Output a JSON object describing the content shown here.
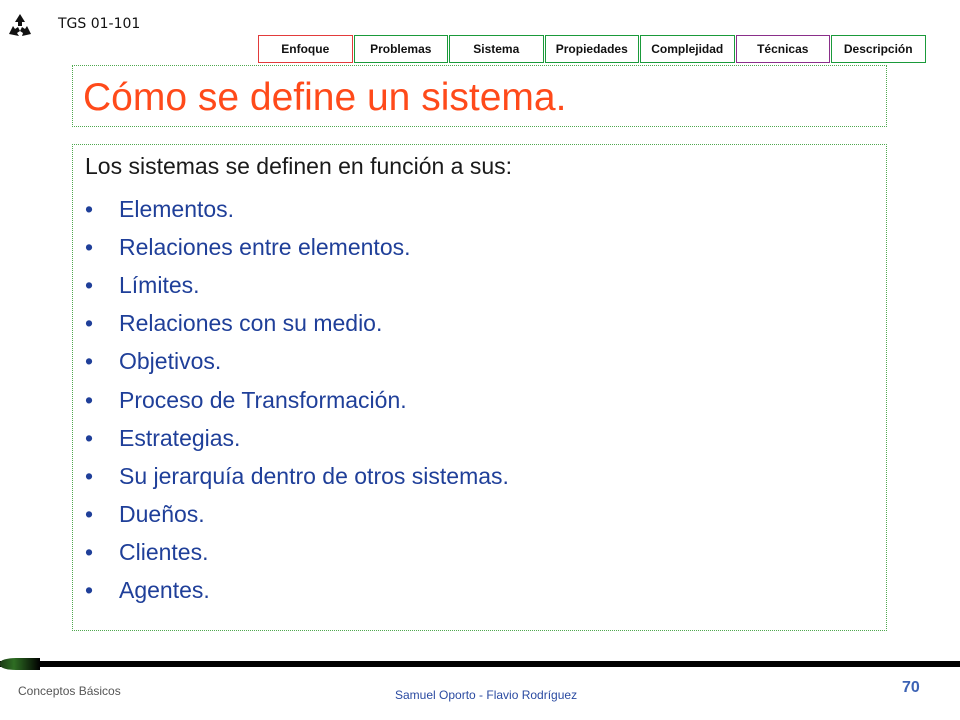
{
  "header": {
    "course_code": "TGS 01-101",
    "logo_icon": "recycle-icon",
    "nav_tabs": [
      {
        "label": "Enfoque",
        "border": "#e23b3b"
      },
      {
        "label": "Problemas",
        "border": "#1a9a3a"
      },
      {
        "label": "Sistema",
        "border": "#1a9a3a"
      },
      {
        "label": "Propiedades",
        "border": "#1a9a3a"
      },
      {
        "label": "Complejidad",
        "border": "#1a9a3a"
      },
      {
        "label": "Técnicas",
        "border": "#8a2f8a"
      },
      {
        "label": "Descripción",
        "border": "#1a9a3a"
      }
    ]
  },
  "slide": {
    "title": "Cómo se define un sistema.",
    "intro": "Los sistemas se definen en función a sus:",
    "bullets": [
      "Elementos.",
      "Relaciones entre elementos.",
      "Límites.",
      "Relaciones con su medio.",
      "Objetivos.",
      "Proceso de Transformación.",
      "Estrategias.",
      "Su jerarquía dentro de otros sistemas.",
      "Dueños.",
      "Clientes.",
      "Agentes."
    ],
    "bullet_symbol": "•"
  },
  "footer": {
    "left": "Conceptos Básicos",
    "center": "Samuel Oporto - Flavio Rodríguez",
    "page": "70"
  },
  "colors": {
    "title": "#ff4a1a",
    "bullet_text": "#1f3f99",
    "box_border": "#4fa84f"
  }
}
